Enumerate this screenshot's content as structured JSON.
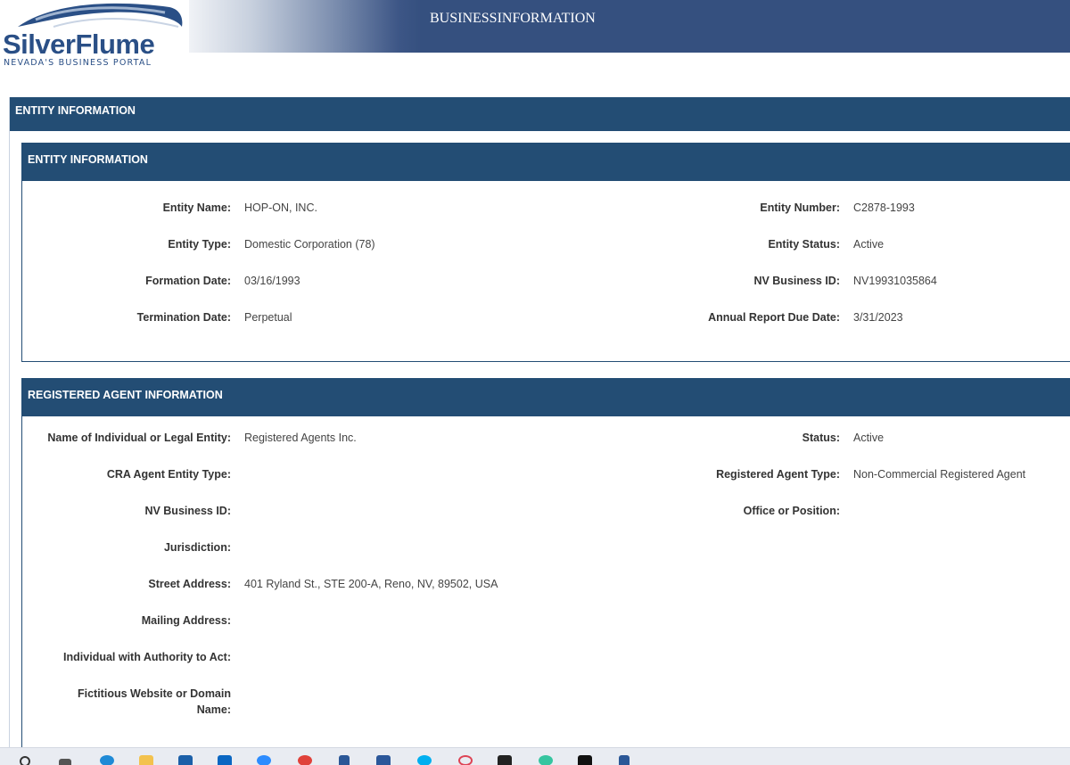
{
  "header": {
    "logo_title": "SilverFlume",
    "logo_subtitle": "NEVADA'S BUSINESS PORTAL",
    "banner_title": "BUSINESSINFORMATION"
  },
  "outer_section": {
    "title": "ENTITY INFORMATION"
  },
  "entity_panel": {
    "title": "ENTITY INFORMATION",
    "entity_name_label": "Entity Name:",
    "entity_name": "HOP-ON, INC.",
    "entity_number_label": "Entity Number:",
    "entity_number": "C2878-1993",
    "entity_type_label": "Entity Type:",
    "entity_type": "Domestic Corporation (78)",
    "entity_status_label": "Entity Status:",
    "entity_status": "Active",
    "formation_date_label": "Formation Date:",
    "formation_date": "03/16/1993",
    "nv_business_id_label": "NV Business ID:",
    "nv_business_id": "NV19931035864",
    "termination_date_label": "Termination Date:",
    "termination_date": "Perpetual",
    "annual_report_label": "Annual Report Due Date:",
    "annual_report_due": "3/31/2023"
  },
  "agent_panel": {
    "title": "REGISTERED AGENT INFORMATION",
    "name_label": "Name of Individual or Legal Entity:",
    "name": "Registered Agents Inc.",
    "status_label": "Status:",
    "status": "Active",
    "cra_type_label": "CRA Agent Entity Type:",
    "agent_type_label": "Registered Agent Type:",
    "agent_type": "Non-Commercial Registered Agent",
    "nv_business_id_label": "NV Business ID:",
    "office_label": "Office or Position:",
    "jurisdiction_label": "Jurisdiction:",
    "street_label": "Street Address:",
    "street_address": "401 Ryland St., STE 200-A, Reno, NV, 89502, USA",
    "mailing_label": "Mailing Address:",
    "authority_label": "Individual with Authority to Act:",
    "website_label_line1": "Fictitious Website or Domain",
    "website_label_line2": "Name:"
  },
  "taskbar": {
    "icons": [
      "search-icon",
      "task-view-icon",
      "edge-icon",
      "file-explorer-icon",
      "mail-icon",
      "outlook-icon",
      "zoom-icon",
      "chrome-icon",
      "document-icon",
      "word-icon",
      "skype-icon",
      "app-icon",
      "app-icon",
      "slack-icon",
      "epic-icon",
      "document-icon"
    ],
    "colors": {
      "bar": "#e9ecf2",
      "accent": "#234d74"
    }
  }
}
